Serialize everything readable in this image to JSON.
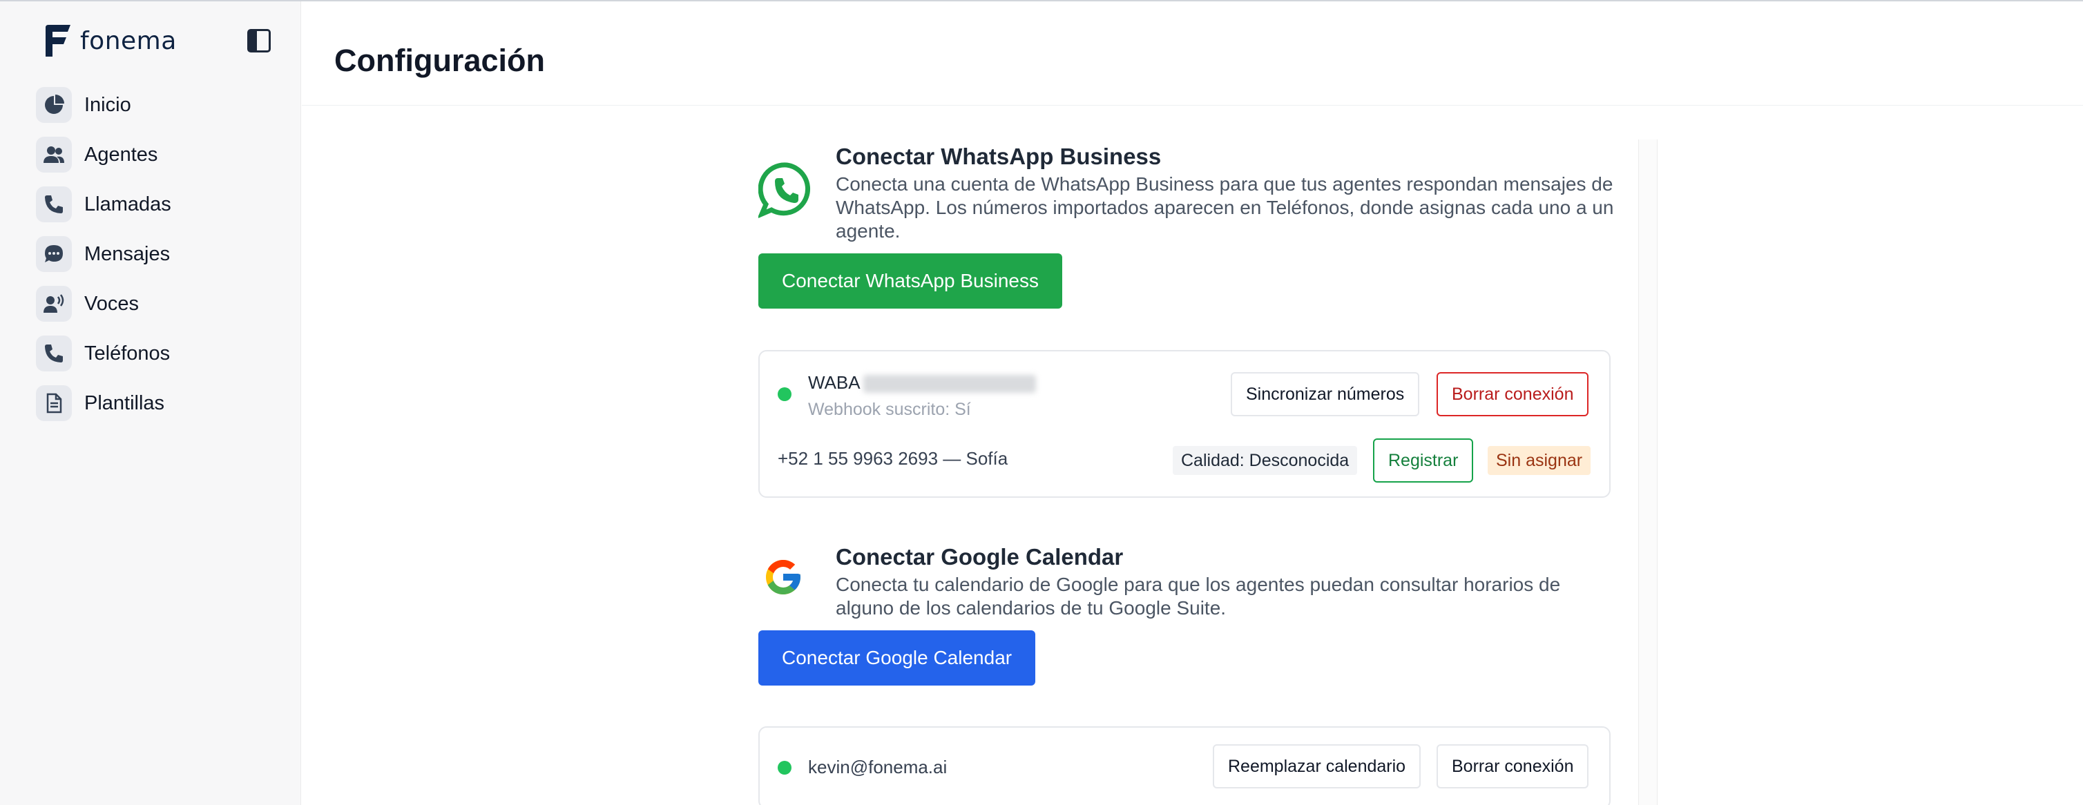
{
  "app": {
    "logo_text": "fonema",
    "brand_color": "#0f2342"
  },
  "sidebar": {
    "items": [
      {
        "label": "Inicio",
        "icon": "pie-chart-icon"
      },
      {
        "label": "Agentes",
        "icon": "users-icon"
      },
      {
        "label": "Llamadas",
        "icon": "phone-icon"
      },
      {
        "label": "Mensajes",
        "icon": "chat-bubble-icon"
      },
      {
        "label": "Voces",
        "icon": "speaking-person-icon"
      },
      {
        "label": "Teléfonos",
        "icon": "phone-icon"
      },
      {
        "label": "Plantillas",
        "icon": "document-icon"
      }
    ]
  },
  "header": {
    "title": "Configuración"
  },
  "whatsapp": {
    "title": "Conectar WhatsApp Business",
    "description": "Conecta una cuenta de WhatsApp Business para que tus agentes respondan mensajes de WhatsApp. Los números importados aparecen en Teléfonos, donde asignas cada uno a un agente.",
    "connect_label": "Conectar WhatsApp Business",
    "accent_color": "#1fa54a",
    "connection": {
      "waba_label": "WABA",
      "webhook_status": "Webhook suscrito: Sí",
      "sync_label": "Sincronizar números",
      "delete_label": "Borrar conexión",
      "phone_line": "+52 1 55 9963 2693 — Sofía",
      "quality_badge": "Calidad: Desconocida",
      "register_label": "Registrar",
      "assignment_badge": "Sin asignar"
    }
  },
  "google_calendar": {
    "title": "Conectar Google Calendar",
    "description": "Conecta tu calendario de Google para que los agentes puedan consultar horarios de alguno de los calendarios de tu Google Suite.",
    "connect_label": "Conectar Google Calendar",
    "accent_color": "#2463eb",
    "connection": {
      "email": "kevin@fonema.ai",
      "replace_label": "Reemplazar calendario",
      "delete_label": "Borrar conexión"
    }
  }
}
